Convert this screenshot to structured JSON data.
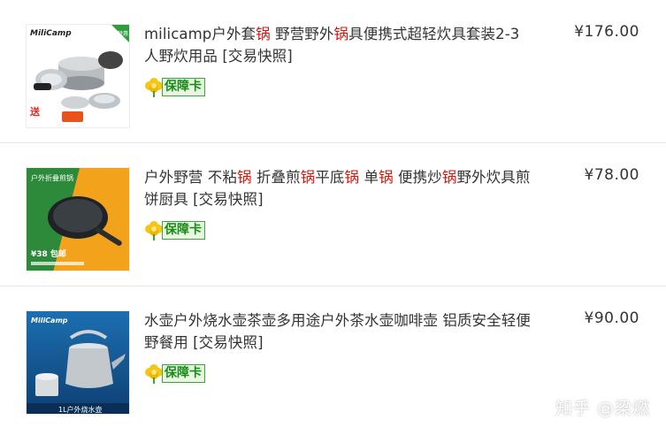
{
  "products": [
    {
      "title_parts": [
        {
          "text": "milicamp户外套",
          "kw": false
        },
        {
          "text": "锅",
          "kw": true
        },
        {
          "text": " 野营野外",
          "kw": false
        },
        {
          "text": "锅",
          "kw": true
        },
        {
          "text": "具便携式超轻炊具套装2-3人野炊用品 [交易快照]",
          "kw": false
        }
      ],
      "price": "¥176.00",
      "badge": "保障卡",
      "image_texts": {
        "brand": "MiliCamp",
        "tag": "特惠",
        "promo": "送"
      }
    },
    {
      "title_parts": [
        {
          "text": "户外野营 不粘",
          "kw": false
        },
        {
          "text": "锅",
          "kw": true
        },
        {
          "text": " 折叠煎",
          "kw": false
        },
        {
          "text": "锅",
          "kw": true
        },
        {
          "text": "平底",
          "kw": false
        },
        {
          "text": "锅",
          "kw": true
        },
        {
          "text": " 单",
          "kw": false
        },
        {
          "text": "锅",
          "kw": true
        },
        {
          "text": " 便携炒",
          "kw": false
        },
        {
          "text": "锅",
          "kw": true
        },
        {
          "text": "野外炊具煎饼厨具 [交易快照]",
          "kw": false
        }
      ],
      "price": "¥78.00",
      "badge": "保障卡",
      "image_texts": {
        "heading": "户外折叠煎锅",
        "price_tag": "¥38 包邮"
      }
    },
    {
      "title_parts": [
        {
          "text": "水壶户外烧水壶茶壶多用途户外茶水壶咖啡壶 铝质安全轻便野餐用 [交易快照]",
          "kw": false
        }
      ],
      "price": "¥90.00",
      "badge": "保障卡",
      "image_texts": {
        "brand": "MiliCamp",
        "caption": "1L户外烧水壶"
      }
    }
  ],
  "watermark": "知乎 @梁燃",
  "colors": {
    "keyword": "#d3150b",
    "badge_green": "#1a8a1a",
    "badge_bg": "#e8f8e0",
    "divider": "#e8e8e8"
  },
  "icons": [
    "cookware-set-image",
    "frying-pan-image",
    "kettle-image",
    "flower-badge-icon"
  ]
}
